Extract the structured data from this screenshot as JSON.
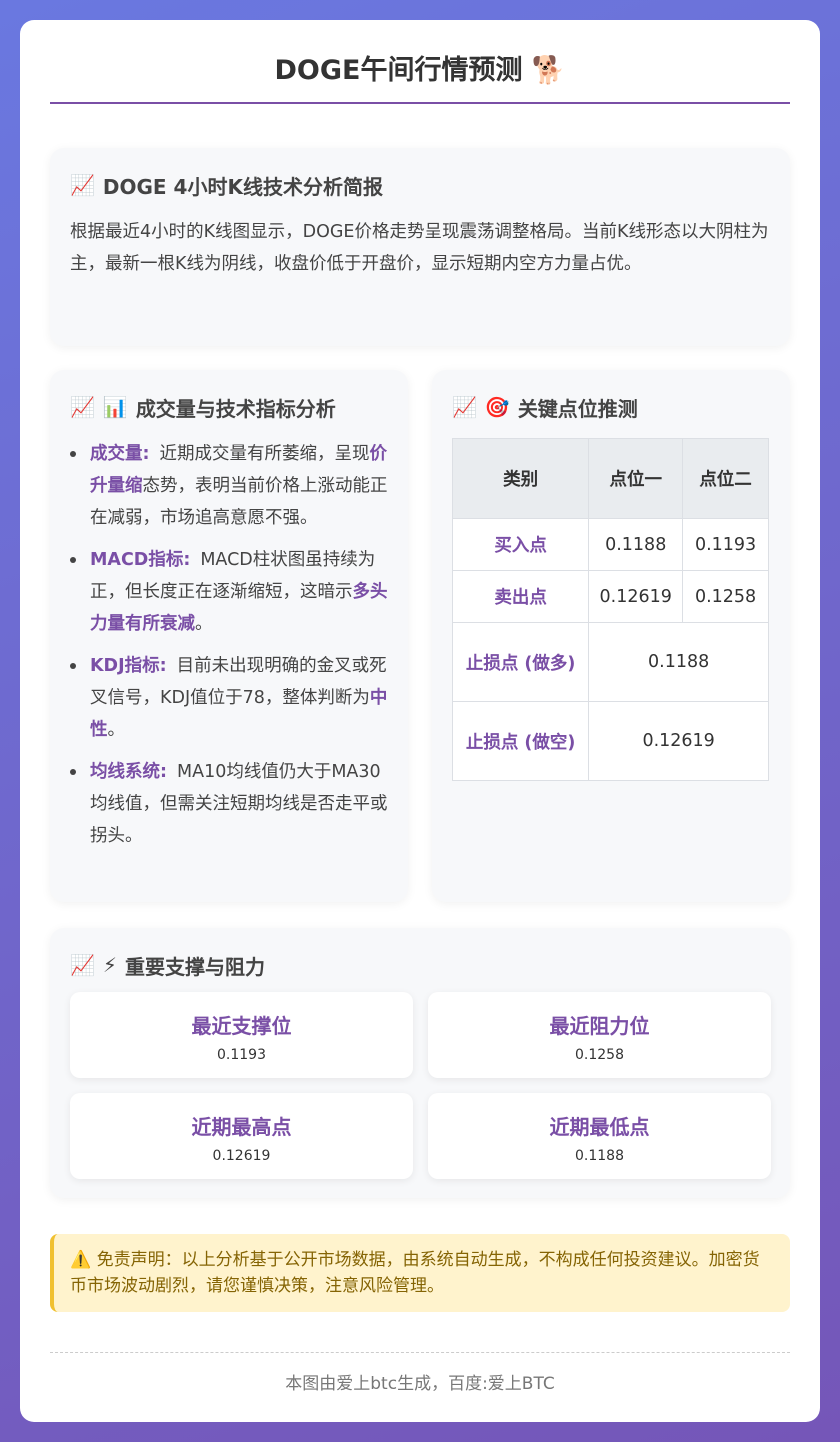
{
  "title": "DOGE午间行情预测 🐕",
  "brief": {
    "icon": "📈",
    "heading": "DOGE 4小时K线技术分析简报",
    "text": "根据最近4小时的K线图显示，DOGE价格走势呈现震荡调整格局。当前K线形态以大阴柱为主，最新一根K线为阴线，收盘价低于开盘价，显示短期内空方力量占优。"
  },
  "indicators": {
    "icon": "📈",
    "icon2": "📊",
    "heading": "成交量与技术指标分析",
    "items": [
      {
        "key": "成交量:",
        "pre": "近期成交量有所萎缩，呈现",
        "em": "价升量缩",
        "post": "态势，表明当前价格上涨动能正在减弱，市场追高意愿不强。"
      },
      {
        "key": "MACD指标:",
        "pre": "MACD柱状图虽持续为正，但长度正在逐渐缩短，这暗示",
        "em": "多头力量有所衰减",
        "post": "。"
      },
      {
        "key": "KDJ指标:",
        "pre": "目前未出现明确的金叉或死叉信号，KDJ值位于78，整体判断为",
        "em": "中性",
        "post": "。"
      },
      {
        "key": "均线系统:",
        "pre": "MA10均线值仍大于MA30均线值，但需关注短期均线是否走平或拐头。",
        "em": "",
        "post": ""
      }
    ]
  },
  "keypoints": {
    "icon": "📈",
    "icon2": "🎯",
    "heading": "关键点位推测",
    "headers": [
      "类别",
      "点位一",
      "点位二"
    ],
    "rows": [
      {
        "label": "买入点",
        "v1": "0.1188",
        "v2": "0.1193"
      },
      {
        "label": "卖出点",
        "v1": "0.12619",
        "v2": "0.1258"
      },
      {
        "label": "止损点 (做多)",
        "v": "0.1188"
      },
      {
        "label": "止损点 (做空)",
        "v": "0.12619"
      }
    ]
  },
  "support": {
    "icon": "📈",
    "icon2": "⚡",
    "heading": "重要支撑与阻力",
    "stats": [
      {
        "label": "最近支撑位",
        "value": "0.1193"
      },
      {
        "label": "最近阻力位",
        "value": "0.1258"
      },
      {
        "label": "近期最高点",
        "value": "0.12619"
      },
      {
        "label": "近期最低点",
        "value": "0.1188"
      }
    ]
  },
  "disclaimer": "⚠️ 免责声明：以上分析基于公开市场数据，由系统自动生成，不构成任何投资建议。加密货币市场波动剧烈，请您谨慎决策，注意风险管理。",
  "footer": "本图由爱上btc生成，百度:爱上BTC"
}
